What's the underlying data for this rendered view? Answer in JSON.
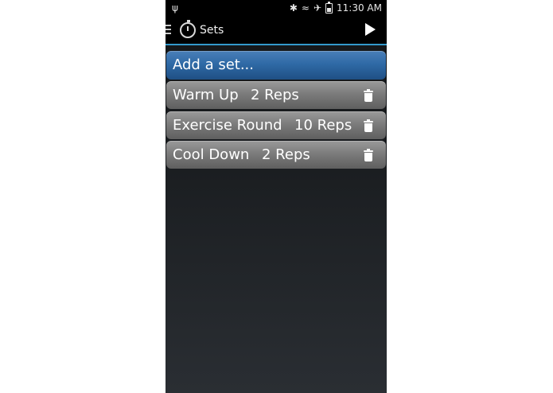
{
  "status_bar": {
    "usb_icon": "usb-icon",
    "bluetooth_icon": "bluetooth-icon",
    "wifi_icon": "wifi-icon",
    "airplane_icon": "airplane-icon",
    "battery_icon": "battery-icon",
    "time": "11:30 AM"
  },
  "action_bar": {
    "title": "Sets",
    "accent_color": "#3399cc"
  },
  "add_set": {
    "label": "Add a set...",
    "color": "#2f6aa6"
  },
  "sets": [
    {
      "name": "Warm Up",
      "reps": "2 Reps"
    },
    {
      "name": "Exercise Round",
      "reps": "10 Reps"
    },
    {
      "name": "Cool Down",
      "reps": "2 Reps"
    }
  ]
}
